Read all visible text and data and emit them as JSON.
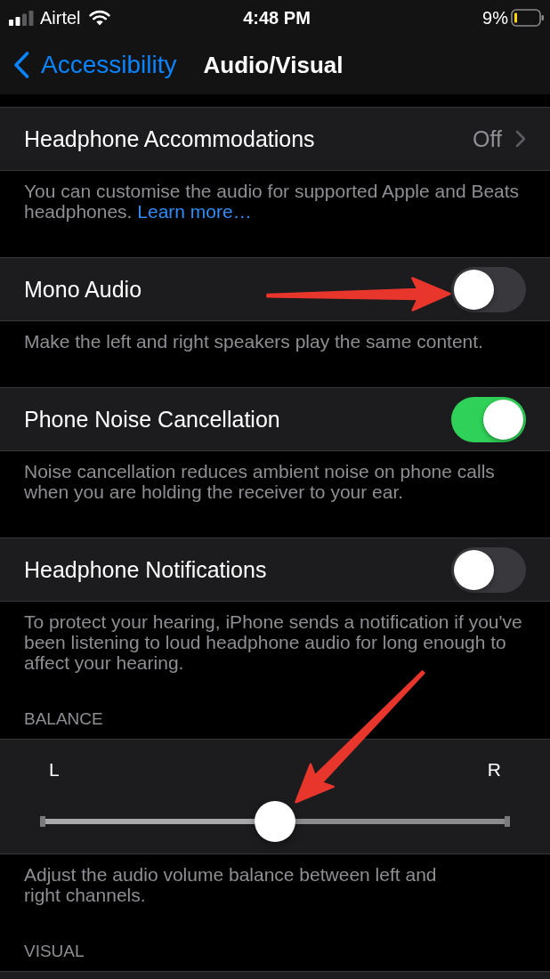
{
  "status_bar": {
    "carrier": "Airtel",
    "time": "4:48 PM",
    "battery": "9%"
  },
  "nav_bar": {
    "back": "Accessibility",
    "title": "Audio/Visual"
  },
  "sections": [
    {
      "cells": [
        {
          "kind": "disclosure",
          "label": "Headphone Accommodations",
          "value": "Off",
          "arrow": false
        }
      ],
      "footer": "You can customise the audio for supported Apple and Beats headphones.",
      "footer_link": "Learn more…"
    },
    {
      "cells": [
        {
          "kind": "toggle",
          "label": "Mono Audio",
          "on": false,
          "arrow": true
        }
      ],
      "footer": "Make the left and right speakers play the same content."
    },
    {
      "cells": [
        {
          "kind": "toggle",
          "label": "Phone Noise Cancellation",
          "on": true,
          "arrow": false
        }
      ],
      "footer": "Noise cancellation reduces ambient noise on phone calls when you are holding the receiver to your ear."
    },
    {
      "cells": [
        {
          "kind": "toggle",
          "label": "Headphone Notifications",
          "on": false,
          "arrow": false
        }
      ],
      "footer": "To protect your hearing, iPhone sends a notification if you've been listening to loud headphone audio for long enough to affect your hearing."
    },
    {
      "header": "BALANCE",
      "cells": [
        {
          "kind": "slider",
          "left_label": "L",
          "right_label": "R",
          "level": 0.5,
          "arrow": true
        }
      ],
      "footer": "Adjust the audio volume balance between left and right channels."
    },
    {
      "header": "VISUAL",
      "cells": [
        {
          "kind": "cut_off"
        }
      ]
    }
  ]
}
